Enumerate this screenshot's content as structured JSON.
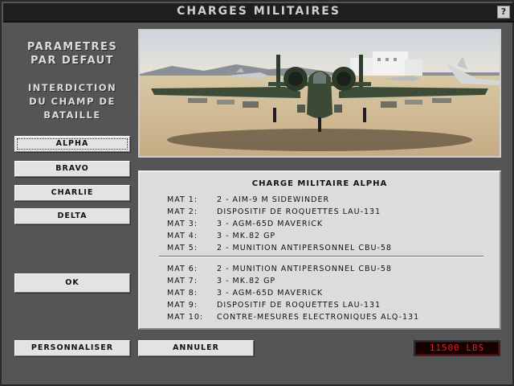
{
  "window": {
    "title": "CHARGES MILITAIRES",
    "help_label": "?"
  },
  "left": {
    "heading1": "PARAMETRES\nPAR DEFAUT",
    "heading2": "INTERDICTION\nDU CHAMP DE\nBATAILLE",
    "loadouts": [
      "ALPHA",
      "BRAVO",
      "CHARLIE",
      "DELTA"
    ],
    "selected": "ALPHA",
    "ok_label": "OK"
  },
  "image": {
    "icon": "a10-aircraft-on-runway"
  },
  "info": {
    "title": "CHARGE MILITAIRE ALPHA",
    "rows": [
      {
        "label": "MAT 1:",
        "value": "2 - AIM-9 M SIDEWINDER"
      },
      {
        "label": "MAT 2:",
        "value": "DISPOSITIF DE ROQUETTES LAU-131"
      },
      {
        "label": "MAT 3:",
        "value": "3 - AGM-65D MAVERICK"
      },
      {
        "label": "MAT 4:",
        "value": "3 - MK.82 GP"
      },
      {
        "label": "MAT 5:",
        "value": "2 - MUNITION ANTIPERSONNEL CBU-58"
      },
      {
        "label": "MAT 6:",
        "value": "2 - MUNITION ANTIPERSONNEL CBU-58"
      },
      {
        "label": "MAT 7:",
        "value": "3 - MK.82 GP"
      },
      {
        "label": "MAT 8:",
        "value": "3 - AGM-65D MAVERICK"
      },
      {
        "label": "MAT 9:",
        "value": "DISPOSITIF DE ROQUETTES LAU-131"
      },
      {
        "label": "MAT 10:",
        "value": "CONTRE-MESURES ELECTRONIQUES ALQ-131"
      }
    ]
  },
  "bottom": {
    "customize_label": "PERSONNALISER",
    "cancel_label": "ANNULER",
    "weight_readout": "11500 LBS"
  },
  "colors": {
    "readout": "#e02020",
    "frame": "#555555",
    "panel": "#dcdcdc"
  }
}
